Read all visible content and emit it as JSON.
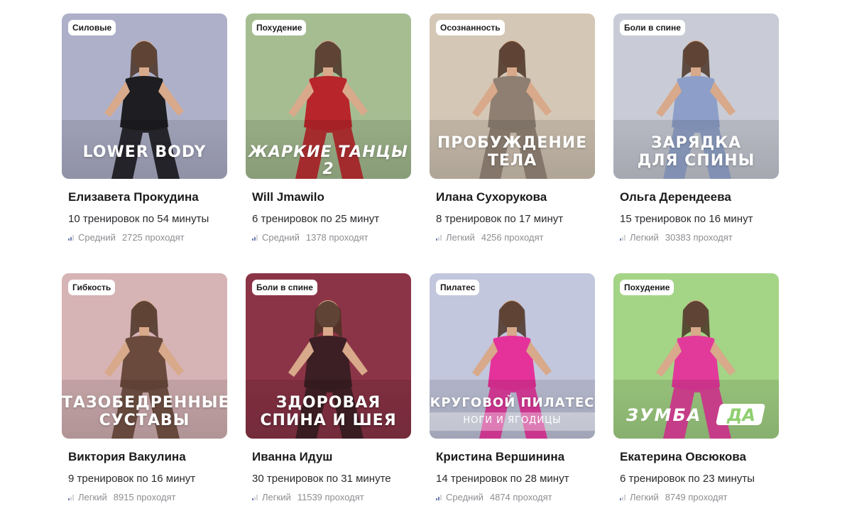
{
  "cards": [
    {
      "tag": "Силовые",
      "cover_title": "LOWER BODY",
      "cover_subtitle": "",
      "trainer": "Елизавета Прокудина",
      "workouts": "10 тренировок по 54 минуты",
      "level": "Средний",
      "participants": "2725 проходят",
      "level_bars": 2,
      "bg": "#aeb0c9",
      "outfit": "#1d1d22"
    },
    {
      "tag": "Похудение",
      "cover_title": "ЖАРКИЕ ТАНЦЫ 2",
      "cover_subtitle": "",
      "trainer": "Will Jmawilo",
      "workouts": "6 тренировок по 25 минут",
      "level": "Средний",
      "participants": "1378 проходят",
      "level_bars": 2,
      "bg": "#a6bd92",
      "outfit": "#b8252b"
    },
    {
      "tag": "Осознанность",
      "cover_title": "ПРОБУЖДЕНИЕ\nТЕЛА",
      "cover_subtitle": "",
      "trainer": "Илана Сухорукова",
      "workouts": "8 тренировок по 17 минут",
      "level": "Легкий",
      "participants": "4256 проходят",
      "level_bars": 1,
      "bg": "#d4c7b6",
      "outfit": "#8e7f72"
    },
    {
      "tag": "Боли в спине",
      "cover_title": "ЗАРЯДКА\nДЛЯ СПИНЫ",
      "cover_subtitle": "",
      "trainer": "Ольга Дерендеева",
      "workouts": "15 тренировок по 16 минут",
      "level": "Легкий",
      "participants": "30383 проходят",
      "level_bars": 1,
      "bg": "#c9ccd6",
      "outfit": "#8d9fc8"
    },
    {
      "tag": "Гибкость",
      "cover_title": "ТАЗОБЕДРЕННЫЕ\nСУСТАВЫ",
      "cover_subtitle": "",
      "trainer": "Виктория Вакулина",
      "workouts": "9 тренировок по 16 минут",
      "level": "Легкий",
      "participants": "8915 проходят",
      "level_bars": 1,
      "bg": "#d6b3b5",
      "outfit": "#6a4a3c"
    },
    {
      "tag": "Боли в спине",
      "cover_title": "ЗДОРОВАЯ\nСПИНА И ШЕЯ",
      "cover_subtitle": "",
      "trainer": "Иванна Идуш",
      "workouts": "30 тренировок по 31 минуте",
      "level": "Легкий",
      "participants": "11539 проходят",
      "level_bars": 1,
      "bg": "#8c3447",
      "outfit": "#3b1f24"
    },
    {
      "tag": "Пилатес",
      "cover_title": "КРУГОВОЙ ПИЛАТЕС",
      "cover_subtitle": "НОГИ И ЯГОДИЦЫ",
      "trainer": "Кристина Вершинина",
      "workouts": "14 тренировок по 28 минут",
      "level": "Средний",
      "participants": "4874 проходят",
      "level_bars": 2,
      "bg": "#c3c7dd",
      "outfit": "#e5329a"
    },
    {
      "tag": "Похудение",
      "cover_title": "ЗУМБА",
      "cover_subtitle": "ДА",
      "trainer": "Екатерина Овсюкова",
      "workouts": "6 тренировок по 23 минуты",
      "level": "Легкий",
      "participants": "8749 проходят",
      "level_bars": 1,
      "bg": "#a4d486",
      "outfit": "#e23a9a"
    }
  ]
}
